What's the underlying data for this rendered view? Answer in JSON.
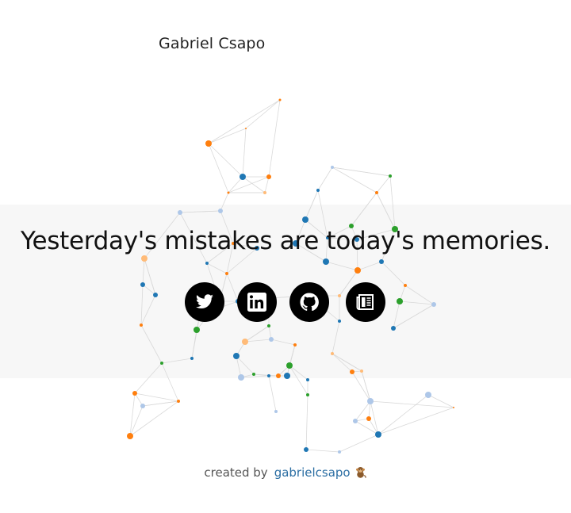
{
  "header": {
    "site_title": "Gabriel Csapo"
  },
  "hero": {
    "quote": "Yesterday's mistakes are today's memories."
  },
  "social_links": [
    {
      "name": "twitter",
      "icon": "twitter-icon"
    },
    {
      "name": "linkedin",
      "icon": "linkedin-icon"
    },
    {
      "name": "github",
      "icon": "github-icon"
    },
    {
      "name": "blog",
      "icon": "newspaper-icon"
    }
  ],
  "footer": {
    "created_label": "created by",
    "author_link": "gabrielcsapo",
    "author_icon": "monkey-icon"
  },
  "colors": {
    "band": "#f7f7f7",
    "icon_bg": "#000000",
    "link": "#2b6ea3",
    "node_orange": "#ff7f0e",
    "node_blue": "#1f77b4",
    "node_green": "#2ca02c",
    "node_light_blue": "#aec7e8",
    "node_peach": "#ffbb78",
    "edge": "#d9d9d9"
  }
}
